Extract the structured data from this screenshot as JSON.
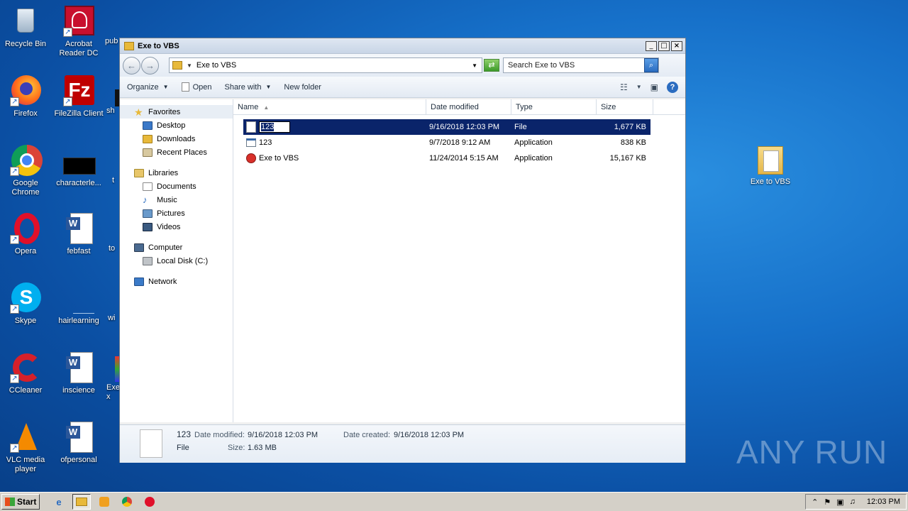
{
  "desktop": {
    "icons": [
      {
        "label": "Recycle Bin"
      },
      {
        "label": "Acrobat Reader DC"
      },
      {
        "label": "pub"
      },
      {
        "label": "Firefox"
      },
      {
        "label": "FileZilla Client"
      },
      {
        "label": "sh"
      },
      {
        "label": "Google Chrome"
      },
      {
        "label": "characterle..."
      },
      {
        "label": "t"
      },
      {
        "label": "Opera"
      },
      {
        "label": "febfast"
      },
      {
        "label": "to"
      },
      {
        "label": "Skype"
      },
      {
        "label": "hairlearning"
      },
      {
        "label": "wi"
      },
      {
        "label": "CCleaner"
      },
      {
        "label": "inscience"
      },
      {
        "label": "Exe x"
      },
      {
        "label": "VLC media player"
      },
      {
        "label": "ofpersonal"
      },
      {
        "label": "Exe to VBS"
      }
    ]
  },
  "window": {
    "title": "Exe to VBS",
    "address_path": "Exe to VBS",
    "search_placeholder": "Search Exe to VBS",
    "toolbar": {
      "organize": "Organize",
      "open": "Open",
      "share_with": "Share with",
      "new_folder": "New folder"
    },
    "nav": {
      "favorites": "Favorites",
      "desktop": "Desktop",
      "downloads": "Downloads",
      "recent_places": "Recent Places",
      "libraries": "Libraries",
      "documents": "Documents",
      "music": "Music",
      "pictures": "Pictures",
      "videos": "Videos",
      "computer": "Computer",
      "local_disk": "Local Disk (C:)",
      "network": "Network"
    },
    "columns": {
      "name": "Name",
      "date_modified": "Date modified",
      "type": "Type",
      "size": "Size"
    },
    "files": [
      {
        "name": "123",
        "date": "9/16/2018 12:03 PM",
        "type": "File",
        "size": "1,677 KB",
        "selected": true,
        "renaming": true
      },
      {
        "name": "123",
        "date": "9/7/2018 9:12 AM",
        "type": "Application",
        "size": "838 KB"
      },
      {
        "name": "Exe to VBS",
        "date": "11/24/2014 5:15 AM",
        "type": "Application",
        "size": "15,167 KB"
      }
    ],
    "details": {
      "name": "123",
      "date_modified_label": "Date modified:",
      "date_modified": "9/16/2018 12:03 PM",
      "date_created_label": "Date created:",
      "date_created": "9/16/2018 12:03 PM",
      "type": "File",
      "size_label": "Size:",
      "size": "1.63 MB"
    }
  },
  "taskbar": {
    "start": "Start",
    "clock": "12:03 PM"
  },
  "watermark": "ANY RUN"
}
